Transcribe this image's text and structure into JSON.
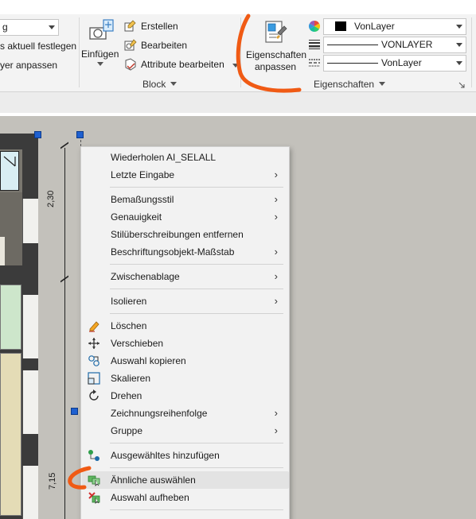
{
  "ribbon": {
    "layer_dropdown_value": "g",
    "layer_cmd_1": "s aktuell festlegen",
    "layer_cmd_2": "yer anpassen",
    "insert_label": "Einfügen",
    "block_create": "Erstellen",
    "block_edit": "Bearbeiten",
    "block_attr_edit": "Attribute bearbeiten",
    "block_group": "Block",
    "match_props_line1": "Eigenschaften",
    "match_props_line2": "anpassen",
    "color_value": "VonLayer",
    "linetype_value": "VONLAYER",
    "lineweight_value": "VonLayer",
    "props_group": "Eigenschaften"
  },
  "drawing": {
    "dim_top": "2,30",
    "dim_bottom": "7,15"
  },
  "context_menu": {
    "items": [
      {
        "label": "Wiederholen AI_SELALL",
        "submenu": false
      },
      {
        "label": "Letzte Eingabe",
        "submenu": true
      },
      {
        "label": "Bemaßungsstil",
        "submenu": true
      },
      {
        "label": "Genauigkeit",
        "submenu": true
      },
      {
        "label": "Stilüberschreibungen entfernen",
        "submenu": false
      },
      {
        "label": "Beschriftungsobjekt-Maßstab",
        "submenu": true
      },
      {
        "label": "Zwischenablage",
        "submenu": true
      },
      {
        "label": "Isolieren",
        "submenu": true
      },
      {
        "label": "Löschen",
        "submenu": false,
        "icon": "eraser-icon"
      },
      {
        "label": "Verschieben",
        "submenu": false,
        "icon": "move-icon"
      },
      {
        "label": "Auswahl kopieren",
        "submenu": false,
        "icon": "copy-icon"
      },
      {
        "label": "Skalieren",
        "submenu": false,
        "icon": "scale-icon"
      },
      {
        "label": "Drehen",
        "submenu": false,
        "icon": "rotate-icon"
      },
      {
        "label": "Zeichnungsreihenfolge",
        "submenu": true
      },
      {
        "label": "Gruppe",
        "submenu": true
      },
      {
        "label": "Ausgewähltes hinzufügen",
        "submenu": false,
        "icon": "add-selected-icon"
      },
      {
        "label": "Ähnliche auswählen",
        "submenu": false,
        "icon": "select-similar-icon",
        "highlighted": true
      },
      {
        "label": "Auswahl aufheben",
        "submenu": false,
        "icon": "deselect-icon"
      }
    ],
    "submenu_glyph": "›"
  },
  "colors": {
    "annotation": "#f05a14",
    "grip": "#1e60d0",
    "menu_bg": "#f2f2f2",
    "menu_highlight": "#e3e3e3",
    "drawing_bg": "#c3c1bb"
  }
}
